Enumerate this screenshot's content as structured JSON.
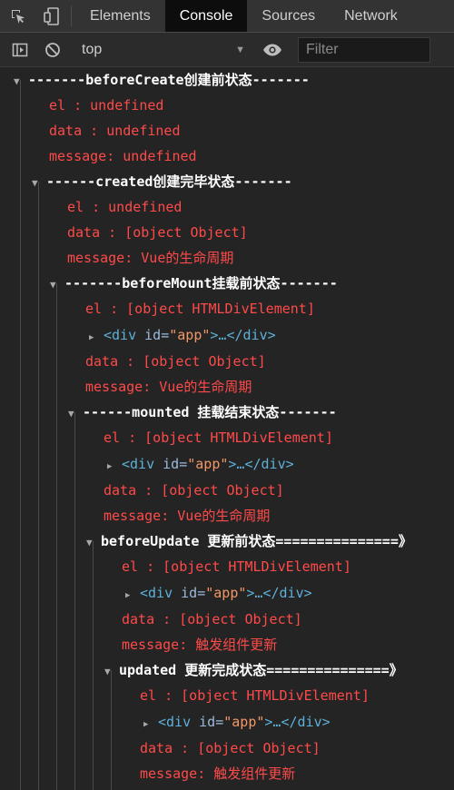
{
  "tabs": {
    "elements": "Elements",
    "console": "Console",
    "sources": "Sources",
    "network": "Network"
  },
  "toolbar": {
    "context": "top",
    "filter_placeholder": "Filter"
  },
  "console": {
    "g1": {
      "header": "-------beforeCreate创建前状态-------",
      "el": "el     : undefined",
      "data": "data   : undefined",
      "message": "message: undefined"
    },
    "g2": {
      "header": "------created创建完毕状态-------",
      "el": "el     : undefined",
      "data": "data   : [object Object]",
      "message": "message: Vue的生命周期"
    },
    "g3": {
      "header": "-------beforeMount挂载前状态-------",
      "el": "el     : [object HTMLDivElement]",
      "data": "data   : [object Object]",
      "message": "message: Vue的生命周期"
    },
    "g4": {
      "header": "------mounted 挂载结束状态-------",
      "el": "el     : [object HTMLDivElement]",
      "data": "data   : [object Object]",
      "message": "message: Vue的生命周期"
    },
    "g5": {
      "header": "beforeUpdate 更新前状态===============》",
      "el": "el     : [object HTMLDivElement]",
      "data": "data   : [object Object]",
      "message": "message: 触发组件更新"
    },
    "g6": {
      "header": "updated 更新完成状态===============》",
      "el": "el     : [object HTMLDivElement]",
      "data": "data   : [object Object]",
      "message": "message: 触发组件更新"
    },
    "node": {
      "open": "<div",
      "attr": " id=",
      "value": "\"app\"",
      "close": ">…</div>"
    }
  }
}
